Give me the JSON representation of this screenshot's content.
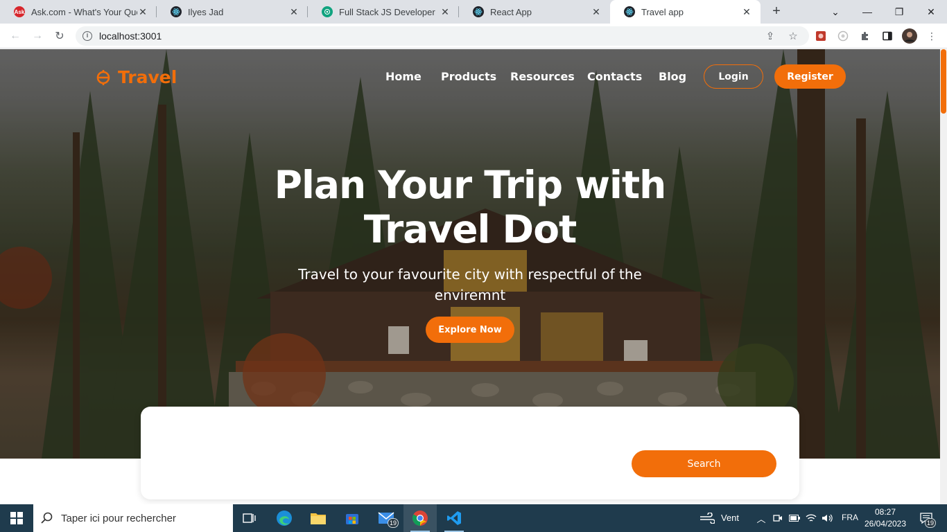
{
  "browser": {
    "tabs": [
      {
        "title": "Ask.com - What's Your Questi",
        "icon": "ask-favicon"
      },
      {
        "title": "Ilyes Jad",
        "icon": "react-favicon"
      },
      {
        "title": "Full Stack JS Developer",
        "icon": "chatgpt-favicon"
      },
      {
        "title": "React App",
        "icon": "react-favicon"
      },
      {
        "title": "Travel app",
        "icon": "react-favicon",
        "active": true
      }
    ],
    "url": "localhost:3001"
  },
  "site": {
    "accent_color": "#f26e0a",
    "logo_text": "Travel",
    "nav": [
      "Home",
      "Products",
      "Resources",
      "Contacts",
      "Blog"
    ],
    "login_label": "Login",
    "register_label": "Register",
    "hero": {
      "title": "Plan Your Trip with Travel Dot",
      "subtitle": "Travel to your favourite city with respectful of the enviremnt",
      "cta_label": "Explore Now"
    },
    "search": {
      "button_label": "Search"
    }
  },
  "taskbar": {
    "search_placeholder": "Taper ici pour rechercher",
    "weather_label": "Vent",
    "language": "FRA",
    "time": "08:27",
    "date": "26/04/2023",
    "mail_badge": "19",
    "notification_badge": "19"
  }
}
